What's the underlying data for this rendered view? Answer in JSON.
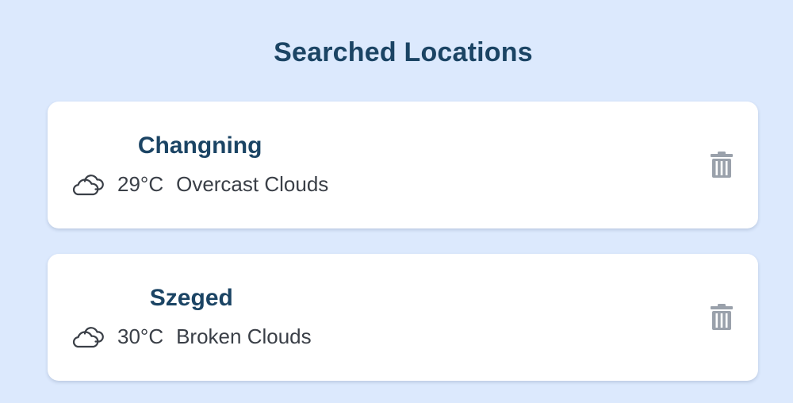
{
  "heading": "Searched Locations",
  "locations": [
    {
      "city": "Changning",
      "temperature": "29°C",
      "condition": "Overcast Clouds",
      "icon": "cloud-icon"
    },
    {
      "city": "Szeged",
      "temperature": "30°C",
      "condition": "Broken Clouds",
      "icon": "cloud-icon"
    }
  ],
  "colors": {
    "background": "#dce9fd",
    "card": "#ffffff",
    "heading": "#1b4464",
    "text": "#3a3f47",
    "icon_gray": "#9aa1ab"
  }
}
